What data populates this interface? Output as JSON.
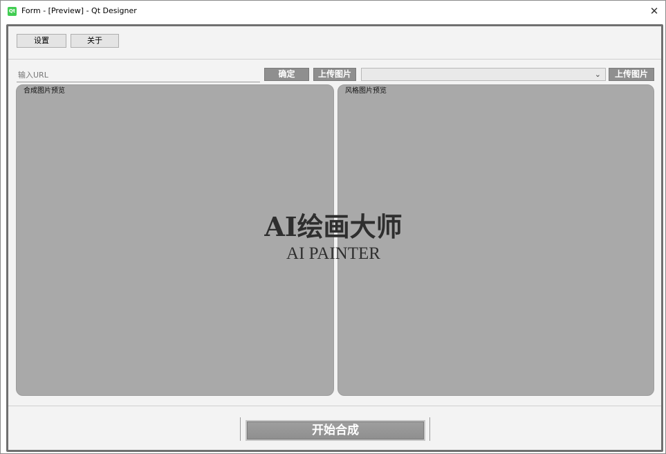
{
  "window": {
    "app_icon_text": "Qt",
    "title": "Form - [Preview] - Qt Designer",
    "close_glyph": "✕"
  },
  "toolbar": {
    "settings_label": "设置",
    "about_label": "关于"
  },
  "url_row": {
    "url_placeholder": "输入URL",
    "confirm_label": "确定",
    "upload_left_label": "上传图片",
    "style_select_value": "",
    "chevron_glyph": "⌄",
    "upload_right_label": "上传图片"
  },
  "panels": {
    "left_label": "合成图片预览",
    "right_label": "风格图片预览",
    "color": "#a9a9a9"
  },
  "logo": {
    "title": "AI绘画大师",
    "subtitle": "AI PAINTER"
  },
  "bottom": {
    "start_label": "开始合成"
  },
  "icons": {
    "app": "qt-logo-icon",
    "close": "close-icon",
    "dropdown": "chevron-down-icon"
  }
}
